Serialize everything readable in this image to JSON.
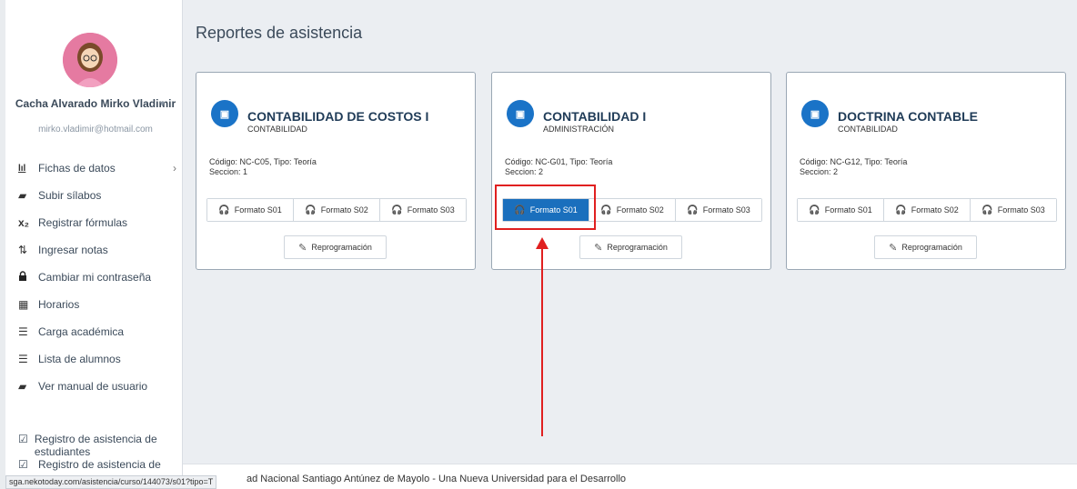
{
  "page": {
    "title": "Reportes de asistencia"
  },
  "user": {
    "name": "Cacha Alvarado Mirko Vladimir",
    "email": "mirko.vladimir@hotmail.com",
    "caret": "▼"
  },
  "menu": [
    {
      "icon": "bar-chart-icon",
      "glyph": "📊",
      "label": "Fichas de datos",
      "arrow": "›"
    },
    {
      "icon": "book-icon",
      "glyph": "▰",
      "label": "Subir sílabos"
    },
    {
      "icon": "subscript-x-icon",
      "glyph": "x₂",
      "label": "Registrar fórmulas"
    },
    {
      "icon": "sort-numeric-icon",
      "glyph": "⇅",
      "label": "Ingresar notas"
    },
    {
      "icon": "lock-icon",
      "glyph": "🔒",
      "label": "Cambiar mi contraseña"
    },
    {
      "icon": "calendar-icon",
      "glyph": "▦",
      "label": "Horarios"
    },
    {
      "icon": "list-icon",
      "glyph": "☰",
      "label": "Carga académica"
    },
    {
      "icon": "list-icon",
      "glyph": "☰",
      "label": "Lista de alumnos"
    },
    {
      "icon": "book-icon",
      "glyph": "▰",
      "label": "Ver manual de usuario"
    }
  ],
  "bottom_items": [
    {
      "label": "Registro de asistencia de estudiantes"
    },
    {
      "label": "Registro de asistencia de"
    }
  ],
  "cards": [
    {
      "icon_glyph": "▣",
      "title": "CONTABILIDAD DE COSTOS I",
      "subtitle": "CONTABILIDAD",
      "code_line": "Código: NC-C05, Tipo: Teoría",
      "section_line": "Seccion: 1",
      "buttons": [
        "Formato S01",
        "Formato S02",
        "Formato S03"
      ],
      "reprog": "Reprogramación"
    },
    {
      "icon_glyph": "▣",
      "title": "CONTABILIDAD I",
      "subtitle": "ADMINISTRACIÓN",
      "code_line": "Código: NC-G01, Tipo: Teoría",
      "section_line": "Seccion: 2",
      "buttons": [
        "Formato S01",
        "Formato S02",
        "Formato S03"
      ],
      "reprog": "Reprogramación"
    },
    {
      "icon_glyph": "▣",
      "title": "DOCTRINA CONTABLE",
      "subtitle": "CONTABILIDAD",
      "code_line": "Código: NC-G12, Tipo: Teoría",
      "section_line": "Seccion: 2",
      "buttons": [
        "Formato S01",
        "Formato S02",
        "Formato S03"
      ],
      "reprog": "Reprogramación"
    }
  ],
  "footer": {
    "text": "ad Nacional Santiago Antúnez de Mayolo - Una Nueva Universidad para el Desarrollo"
  },
  "status_bar": {
    "url": "sga.nekotoday.com/asistencia/curso/144073/s01?tipo=T"
  },
  "colors": {
    "accent": "#1a6fbd",
    "highlight": "#e02020"
  }
}
